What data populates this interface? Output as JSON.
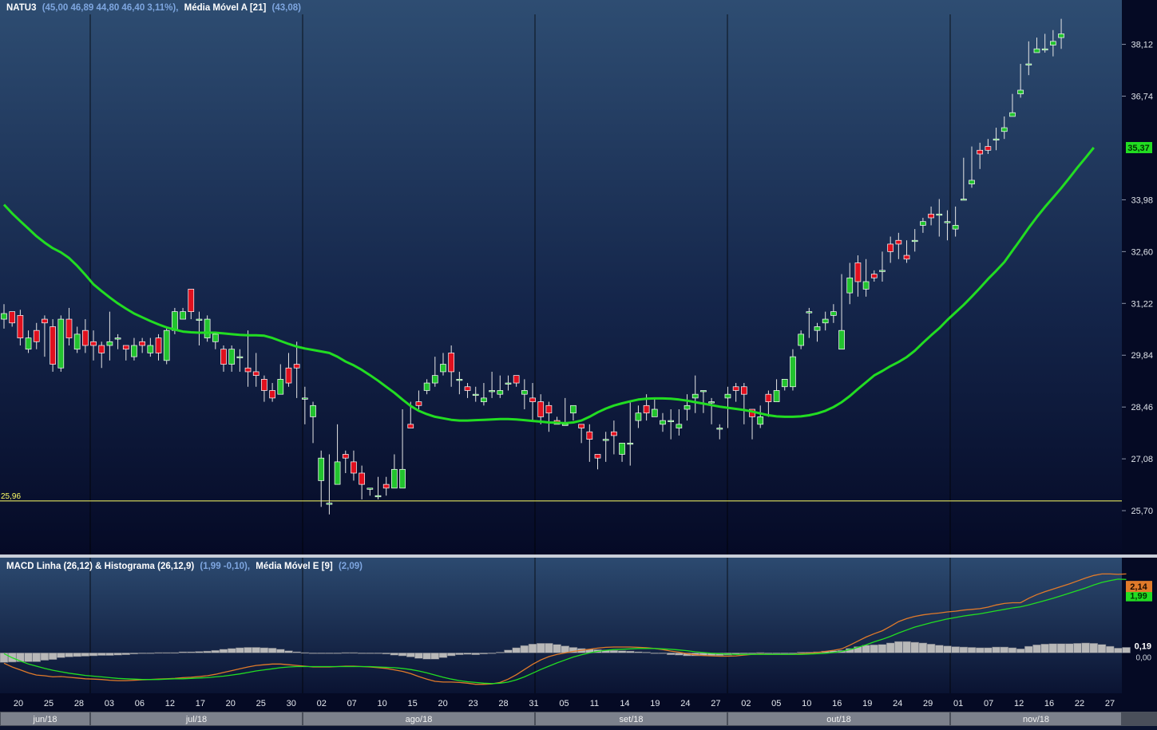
{
  "main_header": {
    "symbol": "NATU3",
    "ohlc": "(45,00  46,89  44,80  46,40  3,11%),",
    "ma_label": "Média Móvel A [21]",
    "ma_value": "(43,08)"
  },
  "macd_header": {
    "label": "MACD Linha (26,12) & Histograma (26,12,9)",
    "values": "(1,99  -0,10),",
    "signal_label": "Média Móvel E [9]",
    "signal_value": "(2,09)"
  },
  "colors": {
    "up": "#22c32e",
    "down": "#e0101e",
    "ma": "#22dd22",
    "macd": "#e07a2a",
    "signal": "#22dd22",
    "histogram": "#b8b8b8",
    "support_line": "#ffff66"
  },
  "support": {
    "value": 25.96,
    "label": "25,96"
  },
  "price_tags": {
    "ma": "35,37"
  },
  "macd_tags": {
    "macd": "2,14",
    "signal": "1,99",
    "hist": "0,19",
    "zero": "0,00"
  },
  "chart_data": {
    "type": "candlestick",
    "y_ticks": [
      "38,12",
      "36,74",
      "33,98",
      "32,60",
      "31,22",
      "29,84",
      "28,46",
      "27,08",
      "25,70"
    ],
    "ylim": [
      25.0,
      38.6
    ],
    "macd_ylim": [
      -0.9,
      2.3
    ],
    "x_ticks": [
      "20",
      "25",
      "28",
      "03",
      "06",
      "12",
      "17",
      "20",
      "25",
      "30",
      "02",
      "07",
      "10",
      "15",
      "20",
      "23",
      "28",
      "31",
      "05",
      "11",
      "14",
      "19",
      "24",
      "27",
      "02",
      "05",
      "10",
      "16",
      "19",
      "24",
      "29",
      "01",
      "07",
      "12",
      "16",
      "22",
      "27"
    ],
    "months": [
      "jun/18",
      "jul/18",
      "ago/18",
      "set/18",
      "out/18",
      "nov/18"
    ],
    "candles": [
      [
        30.8,
        30.95,
        30.6,
        30.55,
        31.2
      ],
      [
        31.0,
        30.7,
        30.9,
        30.6,
        31.0
      ],
      [
        30.9,
        30.3,
        30.3,
        30.1,
        31.05
      ],
      [
        30.0,
        30.3,
        30.2,
        29.9,
        30.5
      ],
      [
        30.5,
        30.2,
        30.4,
        30.0,
        30.7
      ],
      [
        30.8,
        30.7,
        30.6,
        29.8,
        30.9
      ],
      [
        30.6,
        29.6,
        29.5,
        29.4,
        30.8
      ],
      [
        29.5,
        30.8,
        30.5,
        29.4,
        30.9
      ],
      [
        30.8,
        30.3,
        30.2,
        30.1,
        31.1
      ],
      [
        30.0,
        30.4,
        30.3,
        29.9,
        30.6
      ],
      [
        30.5,
        30.1,
        30.0,
        29.9,
        30.8
      ],
      [
        30.2,
        30.1,
        30.1,
        29.7,
        30.5
      ],
      [
        30.1,
        29.9,
        29.7,
        29.5,
        30.2
      ],
      [
        30.1,
        30.2,
        30.1,
        29.7,
        31.0
      ],
      [
        30.3,
        30.3,
        30.1,
        30.0,
        30.4
      ],
      [
        30.1,
        30.0,
        29.9,
        29.7,
        30.1
      ],
      [
        29.8,
        30.1,
        30.0,
        29.7,
        30.3
      ],
      [
        30.2,
        30.1,
        30.0,
        29.9,
        30.3
      ],
      [
        29.9,
        30.1,
        30.0,
        29.8,
        30.3
      ],
      [
        30.3,
        29.9,
        29.7,
        29.7,
        30.4
      ],
      [
        29.7,
        30.5,
        30.4,
        29.6,
        30.6
      ],
      [
        30.5,
        31.0,
        31.0,
        30.4,
        31.1
      ],
      [
        30.8,
        31.0,
        31.0,
        30.8,
        31.1
      ],
      [
        31.6,
        31.0,
        30.8,
        30.8,
        31.6
      ],
      [
        30.8,
        30.8,
        30.2,
        30.1,
        31.0
      ],
      [
        30.3,
        30.8,
        30.7,
        30.2,
        30.9
      ],
      [
        30.2,
        30.4,
        30.0,
        30.0,
        30.4
      ],
      [
        30.0,
        29.6,
        29.5,
        29.4,
        30.1
      ],
      [
        29.6,
        30.0,
        30.0,
        29.4,
        30.1
      ],
      [
        29.8,
        29.8,
        29.6,
        29.4,
        30.0
      ],
      [
        29.5,
        29.4,
        29.1,
        29.0,
        30.5
      ],
      [
        29.4,
        29.3,
        29.2,
        29.0,
        29.9
      ],
      [
        29.2,
        28.9,
        28.9,
        28.6,
        29.3
      ],
      [
        28.9,
        28.7,
        28.9,
        28.6,
        29.1
      ],
      [
        28.8,
        29.2,
        29.2,
        28.8,
        29.6
      ],
      [
        29.5,
        29.1,
        29.3,
        29.0,
        29.9
      ],
      [
        29.6,
        29.5,
        29.5,
        28.7,
        30.2
      ],
      [
        28.7,
        28.7,
        28.2,
        28.0,
        29.0
      ],
      [
        28.2,
        28.5,
        27.6,
        27.5,
        28.6
      ],
      [
        26.5,
        27.1,
        26.6,
        25.8,
        27.3
      ],
      [
        25.9,
        25.9,
        25.9,
        25.6,
        27.2
      ],
      [
        26.4,
        27.0,
        27.2,
        26.4,
        28.0
      ],
      [
        27.2,
        27.1,
        26.9,
        26.7,
        27.3
      ],
      [
        27.0,
        26.7,
        26.7,
        26.5,
        27.3
      ],
      [
        26.7,
        26.4,
        26.1,
        26.0,
        26.9
      ],
      [
        26.3,
        26.3,
        26.2,
        26.1,
        26.3
      ],
      [
        26.1,
        26.1,
        26.1,
        26.0,
        26.6
      ],
      [
        26.4,
        26.3,
        26.4,
        26.1,
        26.6
      ],
      [
        26.3,
        26.8,
        27.0,
        26.3,
        27.2
      ],
      [
        26.3,
        26.8,
        28.2,
        26.3,
        28.4
      ],
      [
        28.0,
        27.9,
        28.3,
        27.9,
        28.6
      ],
      [
        28.6,
        28.5,
        28.7,
        28.4,
        28.9
      ],
      [
        28.9,
        29.1,
        29.1,
        28.8,
        29.2
      ],
      [
        29.1,
        29.3,
        29.4,
        29.0,
        29.8
      ],
      [
        29.4,
        29.6,
        29.5,
        29.3,
        29.9
      ],
      [
        29.9,
        29.4,
        29.5,
        29.0,
        30.1
      ],
      [
        29.2,
        29.2,
        29.0,
        28.8,
        29.4
      ],
      [
        29.0,
        28.9,
        28.9,
        28.7,
        29.1
      ],
      [
        28.8,
        28.8,
        28.8,
        28.6,
        29.0
      ],
      [
        28.6,
        28.7,
        28.9,
        28.5,
        29.1
      ],
      [
        28.9,
        28.9,
        28.8,
        28.7,
        29.4
      ],
      [
        28.8,
        28.9,
        29.2,
        28.7,
        29.3
      ],
      [
        29.1,
        29.1,
        29.3,
        28.9,
        29.3
      ],
      [
        29.3,
        29.1,
        29.1,
        29.0,
        29.3
      ],
      [
        28.8,
        28.9,
        28.9,
        28.4,
        29.2
      ],
      [
        28.7,
        28.6,
        28.4,
        28.1,
        29.1
      ],
      [
        28.6,
        28.2,
        28.4,
        28.0,
        28.8
      ],
      [
        28.5,
        28.3,
        27.9,
        27.8,
        28.6
      ],
      [
        28.1,
        28.0,
        28.1,
        28.0,
        28.2
      ],
      [
        28.0,
        28.0,
        28.1,
        28.0,
        28.7
      ],
      [
        28.3,
        28.5,
        28.4,
        28.1,
        28.5
      ],
      [
        28.0,
        27.9,
        27.8,
        27.5,
        28.0
      ],
      [
        27.8,
        27.6,
        27.2,
        27.0,
        28.0
      ],
      [
        27.2,
        27.1,
        26.9,
        26.8,
        27.2
      ],
      [
        27.6,
        27.6,
        27.7,
        27.0,
        27.8
      ],
      [
        27.8,
        27.7,
        27.3,
        27.2,
        28.1
      ],
      [
        27.2,
        27.5,
        27.3,
        27.0,
        27.3
      ],
      [
        27.5,
        27.5,
        27.2,
        26.9,
        28.6
      ],
      [
        28.1,
        28.3,
        28.3,
        27.9,
        28.5
      ],
      [
        28.5,
        28.3,
        28.4,
        28.1,
        28.8
      ],
      [
        28.2,
        28.4,
        28.3,
        28.2,
        28.7
      ],
      [
        28.0,
        28.1,
        28.2,
        27.8,
        28.3
      ],
      [
        28.1,
        28.1,
        27.8,
        27.6,
        28.4
      ],
      [
        27.9,
        28.0,
        28.2,
        27.7,
        28.4
      ],
      [
        28.4,
        28.5,
        28.5,
        28.1,
        28.8
      ],
      [
        28.7,
        28.8,
        28.7,
        28.3,
        29.3
      ],
      [
        28.9,
        28.9,
        28.4,
        28.3,
        28.9
      ],
      [
        28.6,
        28.6,
        28.2,
        28.0,
        28.7
      ],
      [
        27.9,
        27.9,
        27.9,
        27.6,
        28.0
      ],
      [
        28.7,
        28.8,
        28.3,
        27.9,
        29.0
      ],
      [
        29.0,
        28.9,
        28.8,
        28.6,
        29.1
      ],
      [
        29.0,
        28.8,
        28.4,
        28.0,
        29.1
      ],
      [
        28.4,
        28.2,
        28.1,
        27.6,
        28.4
      ],
      [
        28.0,
        28.2,
        28.2,
        27.9,
        28.5
      ],
      [
        28.8,
        28.6,
        28.6,
        28.2,
        28.9
      ],
      [
        28.6,
        28.9,
        29.0,
        28.6,
        29.2
      ],
      [
        29.0,
        29.2,
        29.0,
        28.9,
        29.2
      ],
      [
        29.0,
        29.8,
        29.8,
        28.9,
        30.0
      ],
      [
        30.1,
        30.4,
        30.4,
        30.0,
        30.5
      ],
      [
        31.0,
        31.0,
        30.4,
        30.3,
        31.1
      ],
      [
        30.5,
        30.6,
        30.4,
        30.2,
        30.7
      ],
      [
        30.7,
        30.8,
        30.7,
        30.5,
        31.0
      ],
      [
        30.9,
        31.0,
        30.9,
        30.7,
        31.2
      ],
      [
        30.0,
        30.5,
        31.7,
        30.0,
        32.0
      ],
      [
        31.5,
        31.9,
        32.1,
        31.2,
        32.3
      ],
      [
        32.3,
        31.8,
        31.4,
        31.4,
        32.5
      ],
      [
        31.6,
        31.8,
        32.0,
        31.4,
        32.4
      ],
      [
        32.0,
        31.9,
        31.9,
        31.8,
        32.1
      ],
      [
        32.1,
        32.1,
        32.4,
        31.8,
        32.6
      ],
      [
        32.8,
        32.6,
        32.7,
        32.3,
        33.0
      ],
      [
        32.9,
        32.8,
        32.5,
        32.4,
        33.1
      ],
      [
        32.5,
        32.4,
        32.8,
        32.3,
        32.9
      ],
      [
        32.9,
        32.9,
        33.1,
        32.6,
        33.2
      ],
      [
        33.3,
        33.4,
        33.4,
        33.1,
        33.5
      ],
      [
        33.6,
        33.5,
        33.7,
        33.3,
        33.8
      ],
      [
        33.6,
        33.6,
        33.7,
        33.0,
        34.0
      ],
      [
        33.4,
        33.4,
        33.4,
        32.9,
        33.7
      ],
      [
        33.2,
        33.3,
        33.8,
        33.0,
        33.8
      ],
      [
        34.0,
        34.0,
        34.2,
        34.0,
        35.1
      ],
      [
        34.4,
        34.5,
        35.1,
        34.3,
        35.4
      ],
      [
        35.3,
        35.2,
        35.2,
        34.8,
        35.5
      ],
      [
        35.4,
        35.3,
        35.5,
        35.2,
        35.6
      ],
      [
        35.6,
        35.6,
        35.8,
        35.3,
        35.9
      ],
      [
        35.8,
        35.9,
        36.1,
        35.6,
        36.2
      ],
      [
        36.2,
        36.3,
        36.6,
        36.2,
        36.8
      ],
      [
        36.8,
        36.9,
        37.3,
        36.7,
        37.6
      ],
      [
        37.6,
        37.6,
        38.0,
        37.3,
        38.2
      ],
      [
        37.9,
        38.0,
        38.2,
        37.9,
        38.3
      ],
      [
        38.0,
        38.0,
        38.3,
        37.9,
        38.4
      ],
      [
        38.1,
        38.2,
        38.3,
        37.8,
        38.5
      ],
      [
        38.3,
        38.4,
        38.7,
        38.0,
        38.8
      ]
    ],
    "ma21": [
      33.85,
      33.62,
      33.41,
      33.21,
      33.01,
      32.84,
      32.69,
      32.58,
      32.43,
      32.22,
      31.98,
      31.73,
      31.55,
      31.38,
      31.22,
      31.08,
      30.95,
      30.85,
      30.75,
      30.66,
      30.58,
      30.52,
      30.47,
      30.45,
      30.44,
      30.44,
      30.44,
      30.42,
      30.4,
      30.38,
      30.37,
      30.37,
      30.36,
      30.3,
      30.22,
      30.14,
      30.07,
      30.02,
      29.98,
      29.94,
      29.9,
      29.8,
      29.67,
      29.57,
      29.45,
      29.31,
      29.16,
      29.0,
      28.84,
      28.66,
      28.49,
      28.36,
      28.27,
      28.2,
      28.16,
      28.12,
      28.1,
      28.1,
      28.11,
      28.12,
      28.13,
      28.14,
      28.14,
      28.13,
      28.11,
      28.09,
      28.07,
      28.05,
      28.04,
      28.03,
      28.05,
      28.1,
      28.2,
      28.32,
      28.42,
      28.5,
      28.56,
      28.61,
      28.66,
      28.68,
      28.69,
      28.69,
      28.68,
      28.66,
      28.63,
      28.59,
      28.55,
      28.51,
      28.47,
      28.44,
      28.41,
      28.38,
      28.34,
      28.29,
      28.24,
      28.21,
      28.2,
      28.2,
      28.21,
      28.24,
      28.29,
      28.36,
      28.46,
      28.59,
      28.75,
      28.94,
      29.12,
      29.3,
      29.42,
      29.55,
      29.66,
      29.79,
      29.96,
      30.17,
      30.37,
      30.56,
      30.78,
      30.98,
      31.18,
      31.4,
      31.63,
      31.87,
      32.09,
      32.32,
      32.62,
      32.92,
      33.23,
      33.52,
      33.79,
      34.04,
      34.29,
      34.56,
      34.84,
      35.1,
      35.37
    ],
    "macd_series": [
      -0.28,
      -0.38,
      -0.46,
      -0.54,
      -0.6,
      -0.62,
      -0.65,
      -0.64,
      -0.66,
      -0.68,
      -0.7,
      -0.71,
      -0.72,
      -0.74,
      -0.75,
      -0.75,
      -0.74,
      -0.73,
      -0.72,
      -0.71,
      -0.7,
      -0.69,
      -0.67,
      -0.66,
      -0.64,
      -0.62,
      -0.58,
      -0.53,
      -0.48,
      -0.43,
      -0.38,
      -0.34,
      -0.32,
      -0.3,
      -0.3,
      -0.32,
      -0.34,
      -0.36,
      -0.38,
      -0.38,
      -0.38,
      -0.37,
      -0.36,
      -0.36,
      -0.37,
      -0.38,
      -0.4,
      -0.42,
      -0.46,
      -0.5,
      -0.56,
      -0.64,
      -0.71,
      -0.77,
      -0.79,
      -0.79,
      -0.8,
      -0.82,
      -0.85,
      -0.85,
      -0.84,
      -0.8,
      -0.71,
      -0.59,
      -0.45,
      -0.31,
      -0.19,
      -0.1,
      -0.04,
      0.0,
      0.04,
      0.07,
      0.1,
      0.13,
      0.15,
      0.16,
      0.16,
      0.16,
      0.15,
      0.14,
      0.12,
      0.09,
      0.05,
      0.02,
      -0.02,
      -0.05,
      -0.07,
      -0.08,
      -0.09,
      -0.09,
      -0.08,
      -0.06,
      -0.04,
      -0.03,
      -0.04,
      -0.04,
      -0.04,
      -0.04,
      -0.02,
      -0.01,
      0.01,
      0.04,
      0.07,
      0.11,
      0.21,
      0.32,
      0.43,
      0.52,
      0.6,
      0.72,
      0.85,
      0.93,
      0.99,
      1.03,
      1.06,
      1.08,
      1.11,
      1.13,
      1.16,
      1.18,
      1.2,
      1.24,
      1.3,
      1.34,
      1.36,
      1.36,
      1.48,
      1.58,
      1.66,
      1.73,
      1.8,
      1.87,
      1.95,
      2.03,
      2.1,
      2.14,
      2.14,
      2.13,
      2.14
    ],
    "signal_series": [
      -0.02,
      -0.13,
      -0.22,
      -0.3,
      -0.36,
      -0.42,
      -0.47,
      -0.51,
      -0.55,
      -0.58,
      -0.61,
      -0.63,
      -0.65,
      -0.67,
      -0.69,
      -0.7,
      -0.71,
      -0.72,
      -0.72,
      -0.72,
      -0.71,
      -0.7,
      -0.7,
      -0.69,
      -0.68,
      -0.67,
      -0.65,
      -0.63,
      -0.6,
      -0.57,
      -0.53,
      -0.49,
      -0.46,
      -0.43,
      -0.4,
      -0.38,
      -0.37,
      -0.37,
      -0.37,
      -0.37,
      -0.37,
      -0.37,
      -0.37,
      -0.37,
      -0.37,
      -0.37,
      -0.38,
      -0.39,
      -0.4,
      -0.42,
      -0.45,
      -0.49,
      -0.54,
      -0.6,
      -0.66,
      -0.71,
      -0.75,
      -0.78,
      -0.8,
      -0.82,
      -0.83,
      -0.82,
      -0.79,
      -0.73,
      -0.65,
      -0.55,
      -0.45,
      -0.36,
      -0.27,
      -0.19,
      -0.11,
      -0.05,
      0.0,
      0.04,
      0.07,
      0.09,
      0.1,
      0.11,
      0.12,
      0.12,
      0.12,
      0.11,
      0.1,
      0.08,
      0.06,
      0.03,
      0.01,
      -0.01,
      -0.02,
      -0.03,
      -0.04,
      -0.04,
      -0.04,
      -0.04,
      -0.04,
      -0.04,
      -0.04,
      -0.04,
      -0.04,
      -0.03,
      -0.02,
      -0.01,
      0.01,
      0.04,
      0.09,
      0.15,
      0.22,
      0.3,
      0.37,
      0.45,
      0.54,
      0.62,
      0.7,
      0.76,
      0.82,
      0.87,
      0.92,
      0.96,
      1.0,
      1.03,
      1.06,
      1.1,
      1.14,
      1.18,
      1.22,
      1.25,
      1.3,
      1.36,
      1.42,
      1.48,
      1.55,
      1.62,
      1.69,
      1.76,
      1.84,
      1.91,
      1.96,
      2.0,
      1.99
    ],
    "histogram": [
      -0.26,
      -0.25,
      -0.24,
      -0.24,
      -0.24,
      -0.2,
      -0.18,
      -0.13,
      -0.11,
      -0.1,
      -0.09,
      -0.08,
      -0.07,
      -0.07,
      -0.06,
      -0.05,
      -0.03,
      -0.01,
      0.0,
      0.01,
      0.01,
      0.01,
      0.03,
      0.03,
      0.04,
      0.05,
      0.07,
      0.1,
      0.12,
      0.14,
      0.15,
      0.15,
      0.14,
      0.13,
      0.1,
      0.06,
      0.03,
      0.01,
      -0.01,
      -0.01,
      -0.01,
      0.0,
      0.01,
      0.01,
      0.0,
      -0.01,
      -0.02,
      -0.03,
      -0.06,
      -0.08,
      -0.11,
      -0.15,
      -0.17,
      -0.17,
      -0.13,
      -0.08,
      -0.05,
      -0.04,
      -0.05,
      -0.03,
      -0.01,
      0.02,
      0.08,
      0.14,
      0.2,
      0.24,
      0.26,
      0.26,
      0.23,
      0.19,
      0.15,
      0.12,
      0.1,
      0.09,
      0.08,
      0.07,
      0.06,
      0.05,
      0.03,
      0.02,
      0.0,
      -0.02,
      -0.05,
      -0.06,
      -0.08,
      -0.08,
      -0.08,
      -0.07,
      -0.07,
      -0.06,
      -0.04,
      -0.02,
      0.0,
      0.01,
      0.0,
      0.0,
      0.0,
      0.0,
      0.02,
      0.02,
      0.03,
      0.05,
      0.06,
      0.07,
      0.12,
      0.17,
      0.21,
      0.22,
      0.23,
      0.27,
      0.31,
      0.31,
      0.29,
      0.27,
      0.24,
      0.21,
      0.19,
      0.17,
      0.16,
      0.15,
      0.14,
      0.14,
      0.16,
      0.16,
      0.14,
      0.11,
      0.18,
      0.22,
      0.24,
      0.25,
      0.25,
      0.25,
      0.26,
      0.27,
      0.26,
      0.23,
      0.18,
      0.13,
      0.15
    ]
  }
}
